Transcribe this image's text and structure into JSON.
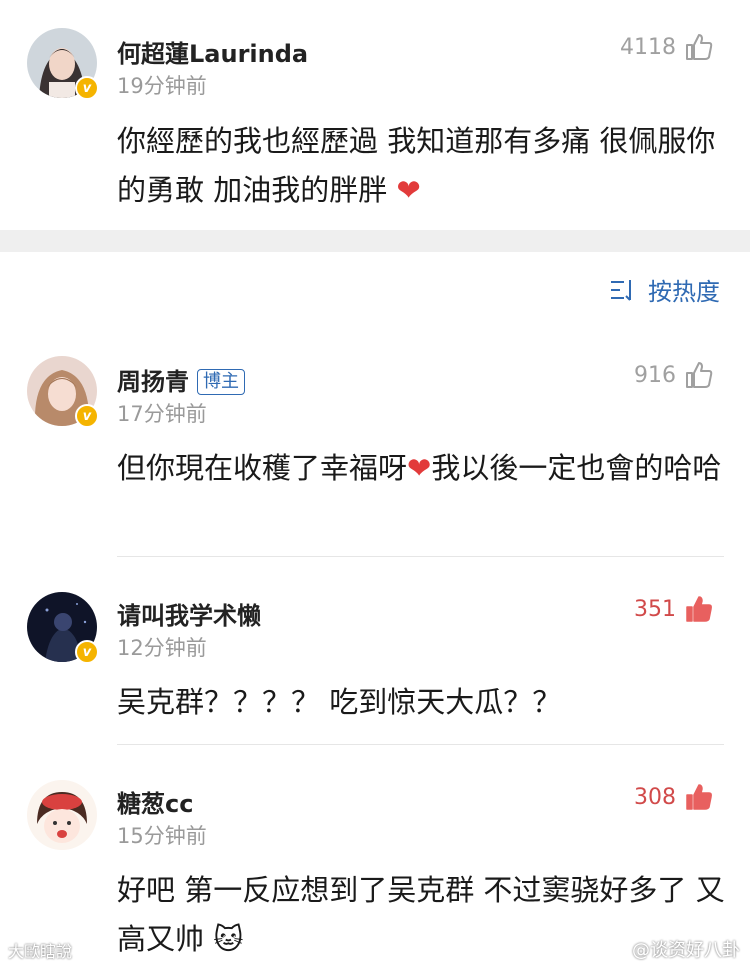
{
  "top_comment": {
    "username": "何超蓮Laurinda",
    "time": "19分钟前",
    "likes": "4118",
    "text": "你經歷的我也經歷過 我知道那有多痛 很佩服你的勇敢 加油我的胖胖",
    "emoji": "❤"
  },
  "sort": {
    "label": "按热度",
    "icon": "sort-icon"
  },
  "comments": [
    {
      "username": "周扬青",
      "badge": "博主",
      "time": "17分钟前",
      "likes": "916",
      "text_before": "但你現在收穫了幸福呀",
      "emoji": "❤",
      "text_after": "我以後一定也會的哈哈"
    },
    {
      "username": "请叫我学术懒",
      "time": "12分钟前",
      "likes": "351",
      "text": "吴克群？？？？ 吃到惊天大瓜？？"
    },
    {
      "username": "糖葱cc",
      "time": "15分钟前",
      "likes": "308",
      "text": "好吧 第一反应想到了吴克群 不过窦骁好多了 又高又帅",
      "emoji": "🐱"
    }
  ],
  "watermarks": {
    "left": "大歐瞎說",
    "right": "@谈资好八卦"
  },
  "colors": {
    "like_hot": "#d14a4a",
    "link_blue": "#2f6ab3",
    "verified": "#f5b400"
  }
}
